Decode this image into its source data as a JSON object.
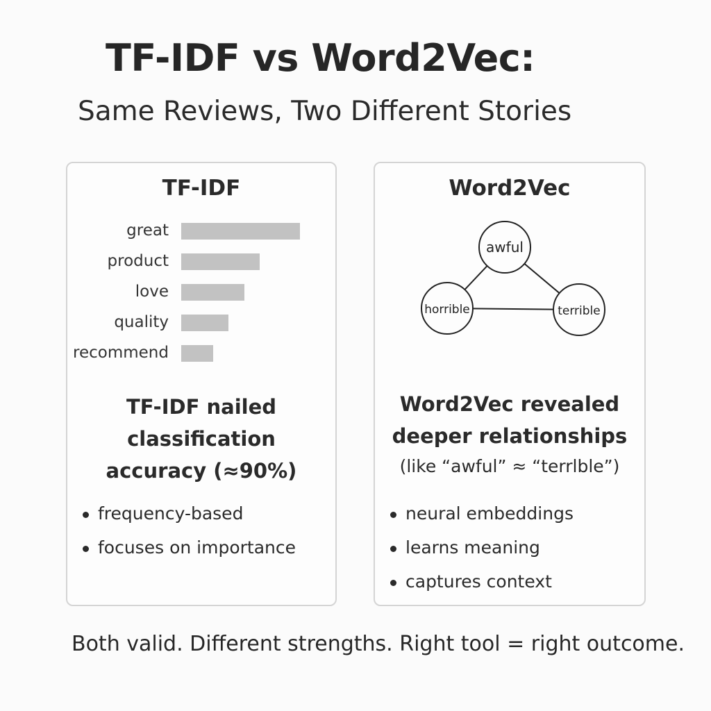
{
  "title": "TF-IDF vs Word2Vec:",
  "subtitle": "Same Reviews, Two Different Stories",
  "left_panel": {
    "heading": "TF-IDF",
    "bars": [
      {
        "label": "great",
        "value": 1.0
      },
      {
        "label": "product",
        "value": 0.66
      },
      {
        "label": "love",
        "value": 0.53
      },
      {
        "label": "quality",
        "value": 0.4
      },
      {
        "label": "recommend",
        "value": 0.27
      }
    ],
    "headline": [
      "TF-IDF nailed",
      "classification",
      "accuracy (≈90%)"
    ],
    "bullets": [
      "frequency-based",
      "focuses on importance"
    ]
  },
  "right_panel": {
    "heading": "Word2Vec",
    "nodes": [
      {
        "id": "awful",
        "label": "awful"
      },
      {
        "id": "horrible",
        "label": "horrible"
      },
      {
        "id": "terrible",
        "label": "terrible"
      }
    ],
    "edges": [
      [
        "awful",
        "horrible"
      ],
      [
        "awful",
        "terrible"
      ],
      [
        "horrible",
        "terrible"
      ]
    ],
    "headline": [
      "Word2Vec revealed",
      "deeper relationships"
    ],
    "note": "(like “awful” ≈ “terrlble”)",
    "bullets": [
      "neural embeddings",
      "learns meaning",
      "captures context"
    ]
  },
  "footer": "Both valid. Different strengths. Right tool = right outcome."
}
